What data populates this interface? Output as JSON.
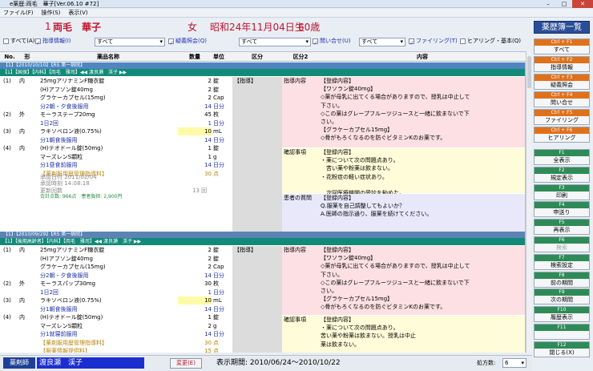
{
  "window": {
    "title": "e薬歴:両毛　華子[Ver.06.10 #72]"
  },
  "menu": [
    "ファイル(F)",
    "操作(S)",
    "表示(V)"
  ],
  "patient": {
    "id": "1",
    "name": "両毛　華子",
    "sex": "女",
    "birth": "昭和24年11月04日生",
    "age": "60歳"
  },
  "filters": {
    "all": "すべて(A)",
    "guidance": "指導情報(I)",
    "guidance_sel": "すべて",
    "disease": "疑義照会(Q)",
    "disease_sel": "すべて",
    "inquiry": "問い合せ(U)",
    "inquiry_sel": "すべて",
    "file": "ファイリング(T)",
    "hearing": "ヒアリング・基本(Q)"
  },
  "columns": {
    "no": "No.",
    "kind": "形",
    "name": "薬品名称",
    "qty": "数量",
    "unit": "単位",
    "div": "区分",
    "div2": "区分2",
    "content": "内容"
  },
  "rx1": {
    "band": "【1】【2010/10/10】【RS 第一病院】",
    "dept": "【1】【国保】【内科】【両毛　雅司】◀◀ 渡良瀬　渓子 ▶▶",
    "rows": [
      {
        "no": "(1)",
        "kind": "内",
        "name": "25mgアリナミンF糖衣錠",
        "qty": "2",
        "unit": "錠"
      },
      {
        "no": "",
        "kind": "",
        "name": "(H)アフソン錠40mg",
        "qty": "2",
        "unit": "錠"
      },
      {
        "no": "",
        "kind": "",
        "name": "グラケーカプセル(15mg)",
        "qty": "2",
        "unit": "Cap"
      },
      {
        "no": "",
        "kind": "",
        "name": "分2朝・夕食後服用",
        "qty": "14",
        "unit": "日分"
      },
      {
        "no": "(2)",
        "kind": "外",
        "name": "モーラステープ20mg",
        "qty": "45",
        "unit": "枚"
      },
      {
        "no": "",
        "kind": "",
        "name": "1日2回",
        "qty": "1",
        "unit": "日分"
      },
      {
        "no": "(3)",
        "kind": "内",
        "name": "ラキソベロン液(0.75%)",
        "qty": "10",
        "unit": "mL"
      },
      {
        "no": "",
        "kind": "",
        "name": "分1朝食後服用",
        "qty": "14",
        "unit": "日分"
      },
      {
        "no": "(4)",
        "kind": "内",
        "name": "(H)テオドール錠(50mg)",
        "qty": "1",
        "unit": "錠"
      },
      {
        "no": "",
        "kind": "",
        "name": "マーズレンS顆粒",
        "qty": "1",
        "unit": "g"
      },
      {
        "no": "",
        "kind": "",
        "name": "分1昼食前服用",
        "qty": "14",
        "unit": "日分"
      },
      {
        "no": "",
        "kind": "",
        "name": "【薬剤服用歴管理指導料】",
        "qty": "30",
        "unit": "点"
      }
    ],
    "approval_date": "承認日付 2011/02/04",
    "approval_time": "承認時刻 14:08:18",
    "update_count": "更新回数",
    "update_val": "13 回",
    "total": "合計点数: 966点　患者負担: 2,900円",
    "div_label": "【指導】",
    "guide_label": "指導内容",
    "guide_text": [
      "【登録内容】",
      "【ワソラン錠40mg】",
      "◇薬が母乳に出てくる場合がありますので、授乳は中止して",
      "下さい。",
      "◇この薬はグレープフルーツジュースと一緒に飲まないで下",
      "さい。",
      "【グラケーカプセル15mg】",
      "◇骨がもろくなるのを防ぐビタミンKのお薬です。"
    ],
    "confirm_label": "確認事項",
    "confirm_text": [
      "【登録内容】",
      "・薬について次の問題点あり。",
      "　苦い薬や粉薬は飲まない。",
      "・花粉症の軽い症状あり。",
      "",
      "　次回医療機関の受診を勧めた。"
    ],
    "question_label": "患者の質問",
    "question_text": [
      "【登録内容】",
      "Q.服薬を自己調整してもよいか？",
      "A.医師の指示通り、服薬を続けてください。"
    ]
  },
  "rx2": {
    "band": "【1】【2010/09/29】【RS 第一病院】",
    "dept": "【1】【後期高齢者】【内科】【両毛　雅司】◀◀ 渡良瀬　渓子 ▶▶",
    "rows": [
      {
        "no": "(1)",
        "kind": "内",
        "name": "25mgアリナミンF糖衣錠",
        "qty": "2",
        "unit": "錠"
      },
      {
        "no": "",
        "kind": "",
        "name": "(H)アフソン錠40mg",
        "qty": "2",
        "unit": "錠"
      },
      {
        "no": "",
        "kind": "",
        "name": "グラケーカプセル(15mg)",
        "qty": "2",
        "unit": "Cap"
      },
      {
        "no": "",
        "kind": "",
        "name": "分2朝・夕食後服用",
        "qty": "14",
        "unit": "日分"
      },
      {
        "no": "(2)",
        "kind": "外",
        "name": "モーラスパップ30mg",
        "qty": "30",
        "unit": "枚"
      },
      {
        "no": "",
        "kind": "",
        "name": "1日2回",
        "qty": "1",
        "unit": "日分"
      },
      {
        "no": "(3)",
        "kind": "内",
        "name": "ラキソベロン液(0.75%)",
        "qty": "10",
        "unit": "mL"
      },
      {
        "no": "",
        "kind": "",
        "name": "分1朝食後服用",
        "qty": "14",
        "unit": "日分"
      },
      {
        "no": "(4)",
        "kind": "内",
        "name": "(H)テオドール錠(50mg)",
        "qty": "1",
        "unit": "錠"
      },
      {
        "no": "",
        "kind": "",
        "name": "マーズレンS顆粒",
        "qty": "2",
        "unit": "g"
      },
      {
        "no": "",
        "kind": "",
        "name": "分1就寝前服用",
        "qty": "14",
        "unit": "日分"
      },
      {
        "no": "",
        "kind": "",
        "name": "【薬剤服用歴管理指導料】",
        "qty": "30",
        "unit": "点"
      },
      {
        "no": "",
        "kind": "",
        "name": "【服薬情報提供料】",
        "qty": "15",
        "unit": "点"
      }
    ],
    "div_label": "【指導】",
    "guide_label": "指導内容",
    "guide_text": [
      "【登録内容】",
      "【ワソラン錠40mg】",
      "◇薬が母乳に出てくる場合がありますので、授乳は中止して",
      "下さい。",
      "◇この薬はグレープフルーツジュースと一緒に飲まないで下",
      "さい。",
      "【グラケーカプセル15mg】",
      "◇骨がもろくなるのを防ぐビタミンKのお薬です。"
    ],
    "confirm_label": "確認事項",
    "confirm_text": [
      "【登録内容】",
      "・薬について次の問題点あり。",
      "苦い薬や粉薬は飲まない。授乳は中止",
      "薬は飲まない。"
    ]
  },
  "side": {
    "title": "薬歴簿一覧",
    "top": [
      {
        "key": "Ctrl + F1",
        "label": "すべて"
      },
      {
        "key": "Ctrl + F2",
        "label": "指導情報"
      },
      {
        "key": "Ctrl + F3",
        "label": "疑義照会"
      },
      {
        "key": "Ctrl + F4",
        "label": "問い合せ"
      },
      {
        "key": "Ctrl + F5",
        "label": "ファイリング"
      },
      {
        "key": "Ctrl + F6",
        "label": "ヒアリング"
      }
    ],
    "fkeys": [
      {
        "key": "F1",
        "label": "全表示"
      },
      {
        "key": "F2",
        "label": "規定表示"
      },
      {
        "key": "F3",
        "label": "印刷"
      },
      {
        "key": "F4",
        "label": "申送り"
      },
      {
        "key": "F5",
        "label": "再表示"
      },
      {
        "key": "F6",
        "label": "検索"
      },
      {
        "key": "F7",
        "label": "検索設定"
      },
      {
        "key": "F8",
        "label": "前の期間"
      },
      {
        "key": "F9",
        "label": "次の期間"
      },
      {
        "key": "F10",
        "label": "履歴表示"
      },
      {
        "key": "F11",
        "label": ""
      },
      {
        "key": "F12",
        "label": "閉じる(X)"
      }
    ]
  },
  "bottom": {
    "role": "薬剤師",
    "pharmacist": "渡良瀬　渓子",
    "change": "変更(E)",
    "period": "表示期間: 2010/06/24〜2010/10/22",
    "count_label": "処方数:",
    "count": "6"
  }
}
